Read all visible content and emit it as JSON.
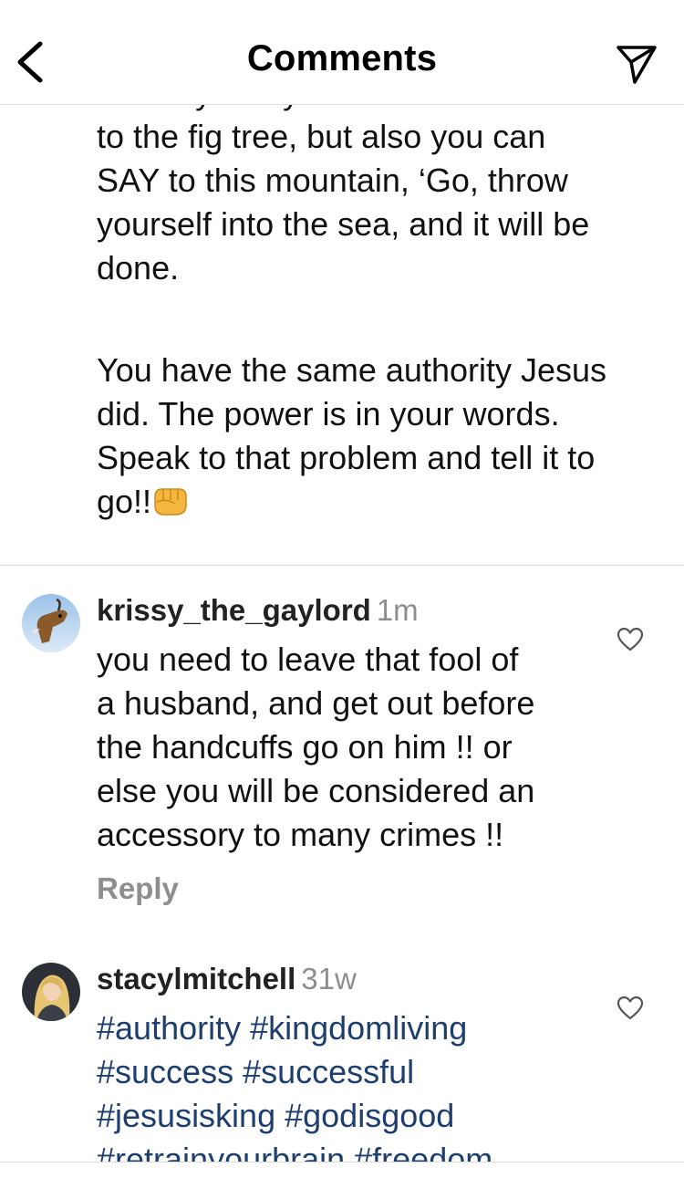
{
  "header": {
    "title": "Comments"
  },
  "continuation": {
    "partial_line": "not only can you do what was done",
    "line1": "to the fig tree, but also you can\nSAY to this mountain, ‘Go, throw\nyourself into the sea, and it will be\ndone.",
    "line2_text": "You have the same authority Jesus\ndid. The power is in your words.\nSpeak to that problem and tell it to\ngo!!",
    "emoji_icon": "fist-bump-emoji"
  },
  "comments": [
    {
      "username": "krissy_the_gaylord",
      "time": "1m",
      "text": "you need to leave that fool of\na husband, and get out before\nthe handcuffs go on him !! or\nelse you will be considered an\naccessory to many crimes !!",
      "reply_label": "Reply"
    },
    {
      "username": "stacylmitchell",
      "time": "31w",
      "text": "#authority #kingdomliving\n#success #successful\n#jesusisking #godisgood\n#retrainyourbrain #freedom"
    }
  ],
  "colors": {
    "hashtag": "#1e3f6e",
    "muted": "#8e8e8e",
    "divider": "#dbdbdb"
  }
}
